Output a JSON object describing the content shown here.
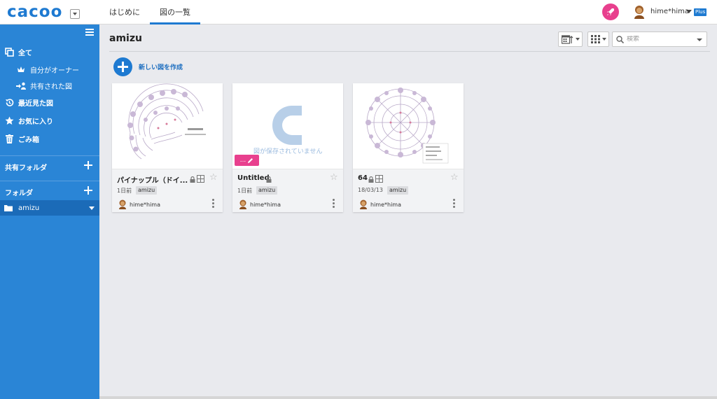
{
  "app": {
    "logo_text": "cacoo",
    "nav": [
      {
        "label": "はじめに"
      },
      {
        "label": "図の一覧"
      }
    ],
    "user": {
      "name": "hime*hima",
      "plan_badge": "Plus"
    }
  },
  "sidebar": {
    "items": [
      {
        "label": "全て",
        "icon": "all-diagrams-icon"
      },
      {
        "label": "自分がオーナー",
        "icon": "crown-icon"
      },
      {
        "label": "共有された図",
        "icon": "shared-user-icon"
      },
      {
        "label": "最近見た図",
        "icon": "history-icon"
      },
      {
        "label": "お気に入り",
        "icon": "star-icon"
      },
      {
        "label": "ごみ箱",
        "icon": "trash-icon"
      }
    ],
    "shared_folder_label": "共有フォルダ",
    "folder_label": "フォルダ",
    "folders": [
      {
        "name": "amizu"
      }
    ]
  },
  "main": {
    "title": "amizu",
    "search_placeholder": "検索",
    "new_diagram_label": "新しい図を作成",
    "cards": [
      {
        "name": "パイナップル（ドイ...",
        "date": "1日前",
        "tag": "amizu",
        "owner": "hime*hima",
        "thumbnail": "crochet-half-pattern"
      },
      {
        "name": "Untitled",
        "date": "1日前",
        "tag": "amizu",
        "owner": "hime*hima",
        "thumbnail": "empty",
        "empty_message": "図が保存されていません",
        "edit_label": "..."
      },
      {
        "name": "64",
        "date": "18/03/13",
        "tag": "amizu",
        "owner": "hime*hima",
        "thumbnail": "crochet-doily-pattern"
      }
    ]
  },
  "colors": {
    "brand": "#1e7ad1",
    "sidebar": "#2a85d6",
    "accent_pink": "#e8408e"
  }
}
